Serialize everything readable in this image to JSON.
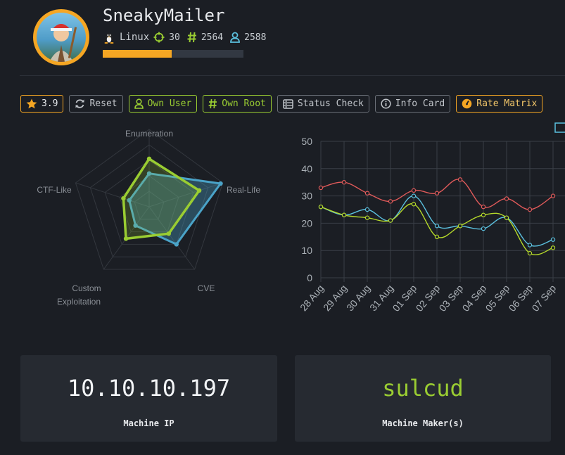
{
  "machine": {
    "name": "SneakyMailer",
    "os": "Linux",
    "points": "30",
    "root_owns": "2564",
    "user_owns": "2588",
    "difficulty_progress": 0.49
  },
  "toolbar": {
    "rating": "3.9",
    "reset": "Reset",
    "own_user": "Own User",
    "own_root": "Own Root",
    "status_check": "Status Check",
    "info_card": "Info Card",
    "rate_matrix": "Rate Matrix"
  },
  "radar": {
    "labels": [
      "Enumeration",
      "Real-Life",
      "CVE",
      "Custom",
      "Exploitation",
      "CTF-Like"
    ],
    "axes": [
      "Enumeration",
      "Real-Life",
      "CVE",
      "Custom Exploitation",
      "CTF-Like"
    ],
    "series": [
      {
        "color": "#4aa3c8",
        "values": [
          4.3,
          9.7,
          6.0,
          3.0,
          2.7
        ]
      },
      {
        "color": "#9acd32",
        "values": [
          6.2,
          6.8,
          4.3,
          5.1,
          3.5
        ]
      }
    ],
    "max": 10
  },
  "chart_data": {
    "type": "line",
    "categories": [
      "28 Aug",
      "29 Aug",
      "30 Aug",
      "31 Aug",
      "01 Sep",
      "02 Sep",
      "03 Sep",
      "04 Sep",
      "05 Sep",
      "06 Sep",
      "07 Sep"
    ],
    "ylim": [
      0,
      50
    ],
    "yticks": [
      "0",
      "10",
      "20",
      "30",
      "40",
      "50"
    ],
    "series": [
      {
        "color": "#e05a5a",
        "values": [
          33,
          35,
          31,
          28,
          32,
          31,
          36,
          26,
          29,
          25,
          30
        ]
      },
      {
        "color": "#5bc0de",
        "values": [
          26,
          23,
          25,
          21,
          30,
          19,
          19,
          18,
          22,
          12,
          14
        ]
      },
      {
        "color": "#b5d92a",
        "values": [
          26,
          23,
          22,
          21,
          27,
          15,
          19,
          23,
          22,
          9,
          11
        ]
      }
    ]
  },
  "panels": {
    "ip": "10.10.10.197",
    "ip_caption": "Machine IP",
    "maker": "sulcud",
    "maker_caption": "Machine Maker(s)"
  },
  "colors": {
    "accent": "#f5a623",
    "green": "#9acd32",
    "blue": "#5bc0de"
  }
}
